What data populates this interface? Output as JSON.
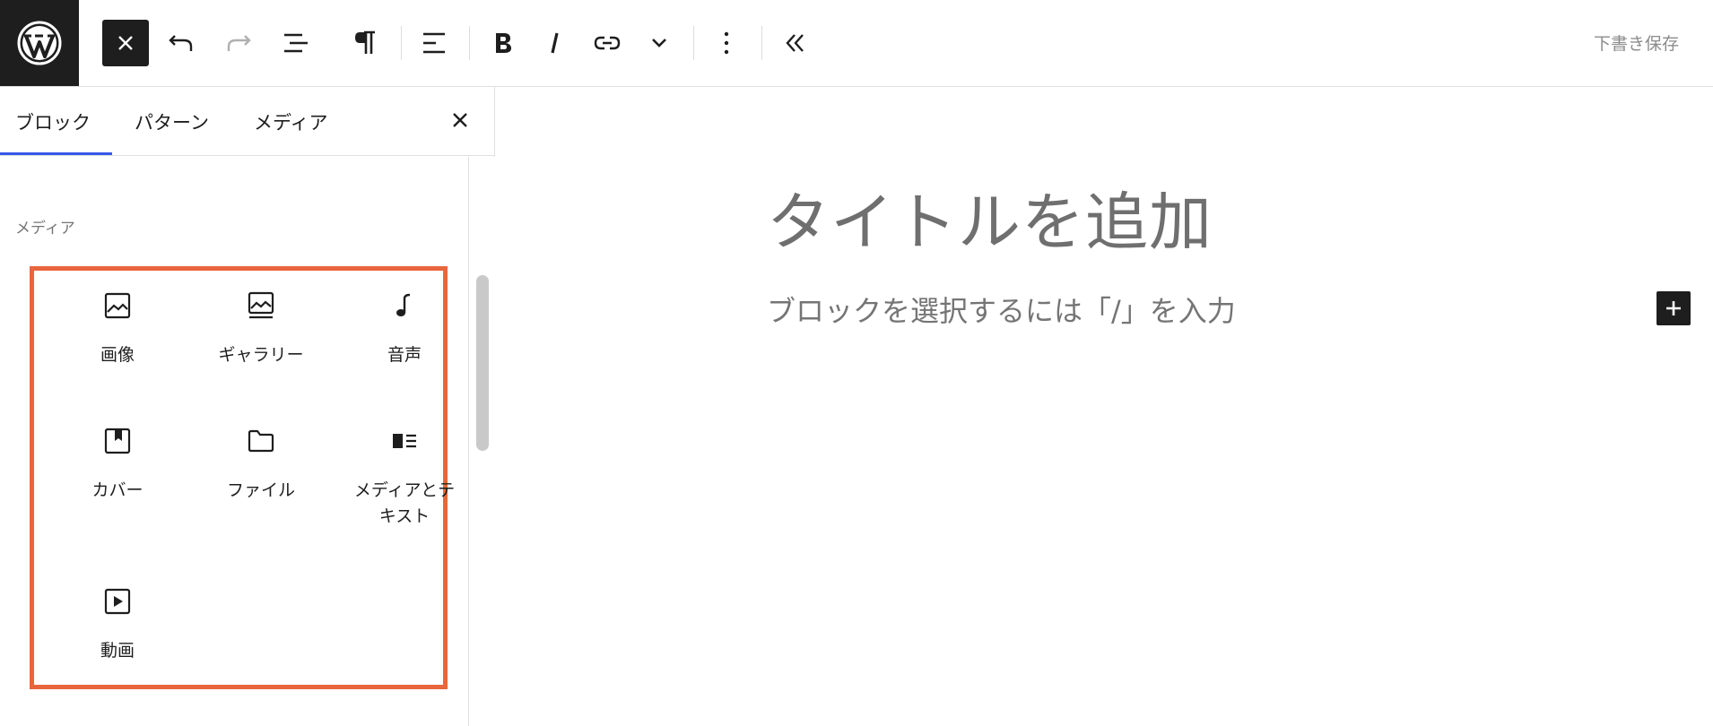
{
  "toolbar": {
    "logo_icon": "wordpress-logo-icon",
    "buttons": [
      {
        "name": "close-inserter-button",
        "icon": "close-icon"
      },
      {
        "name": "undo-button",
        "icon": "undo-icon"
      },
      {
        "name": "redo-button",
        "icon": "redo-icon"
      },
      {
        "name": "document-overview-button",
        "icon": "list-view-icon"
      },
      {
        "name": "paragraph-button",
        "icon": "pilcrow-icon"
      },
      {
        "name": "align-button",
        "icon": "align-left-icon"
      },
      {
        "name": "bold-button",
        "icon": "bold-icon"
      },
      {
        "name": "italic-button",
        "icon": "italic-icon"
      },
      {
        "name": "link-button",
        "icon": "link-icon"
      },
      {
        "name": "more-formats-button",
        "icon": "chevron-down-icon"
      },
      {
        "name": "options-button",
        "icon": "more-vertical-icon"
      },
      {
        "name": "collapse-button",
        "icon": "chevron-double-left-icon"
      }
    ],
    "save_draft_label": "下書き保存"
  },
  "sidebar": {
    "tabs": [
      {
        "label": "ブロック",
        "active": true
      },
      {
        "label": "パターン",
        "active": false
      },
      {
        "label": "メディア",
        "active": false
      }
    ],
    "category_label": "メディア",
    "blocks": [
      {
        "label": "画像",
        "icon": "image-icon"
      },
      {
        "label": "ギャラリー",
        "icon": "gallery-icon"
      },
      {
        "label": "音声",
        "icon": "audio-icon"
      },
      {
        "label": "カバー",
        "icon": "cover-icon"
      },
      {
        "label": "ファイル",
        "icon": "folder-icon"
      },
      {
        "label": "メディアとテキスト",
        "icon": "media-text-icon"
      },
      {
        "label": "動画",
        "icon": "video-icon"
      }
    ],
    "highlight_color": "#e8663d"
  },
  "editor": {
    "title_placeholder": "タイトルを追加",
    "paragraph_placeholder": "ブロックを選択するには「/」を入力",
    "add_block_icon": "plus-icon"
  },
  "colors": {
    "accent": "#3858e9",
    "dark": "#1e1e1e"
  }
}
